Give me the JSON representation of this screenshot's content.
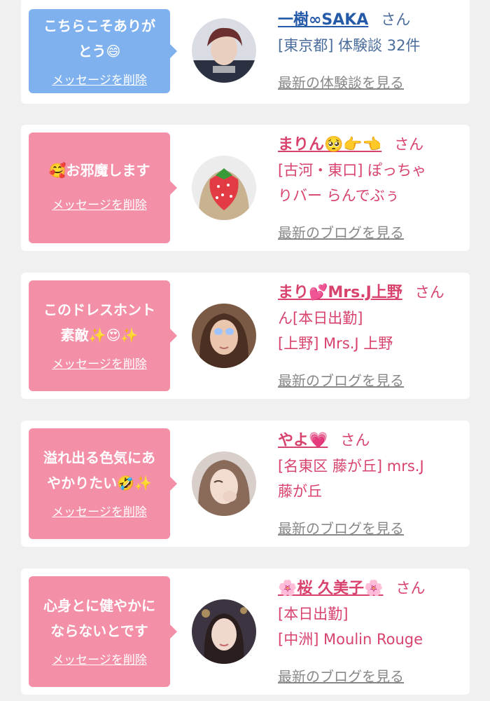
{
  "colors": {
    "blue_bubble": "#7fb1ee",
    "pink_bubble": "#f38fa6",
    "blue_name": "#245aa8",
    "pink_name": "#d8436d",
    "link_gray": "#888888"
  },
  "delete_label": "メッセージを削除",
  "suffix": "さん",
  "cards": [
    {
      "message": [
        "こちらこそありが",
        "とう😄"
      ],
      "avatar_icon": "male-host-photo",
      "name": "一樹∞SAKA",
      "details": [
        "[東京都] 体験談 32件"
      ],
      "link": "最新の体験談を見る"
    },
    {
      "message": [
        "🥰お邪魔します"
      ],
      "avatar_icon": "strawberry-face-photo",
      "name": "まりん🥺👉👈",
      "details": [
        "[古河・東口] ぽっちゃ",
        "りバー らんでぶぅ"
      ],
      "link": "最新のブログを見る"
    },
    {
      "message": [
        "このドレスホント",
        "素敵✨😍✨"
      ],
      "avatar_icon": "woman-photo",
      "name": "まり💕Mrs.J上野",
      "details": [
        "ん[本日出勤]",
        "[上野] Mrs.J 上野"
      ],
      "link": "最新のブログを見る"
    },
    {
      "message": [
        "溢れ出る色気にあ",
        "やかりたい🤣✨"
      ],
      "avatar_icon": "woman-photo",
      "name": "やよ💗",
      "details": [
        "[名東区 藤が丘] mrs.J",
        "藤が丘"
      ],
      "link": "最新のブログを見る"
    },
    {
      "message": [
        "心身とに健やかに",
        "ならないとです"
      ],
      "avatar_icon": "woman-photo",
      "name": "🌸桜 久美子🌸",
      "details": [
        "[本日出勤]",
        "[中洲] Moulin Rouge"
      ],
      "link": "最新のブログを見る"
    }
  ]
}
